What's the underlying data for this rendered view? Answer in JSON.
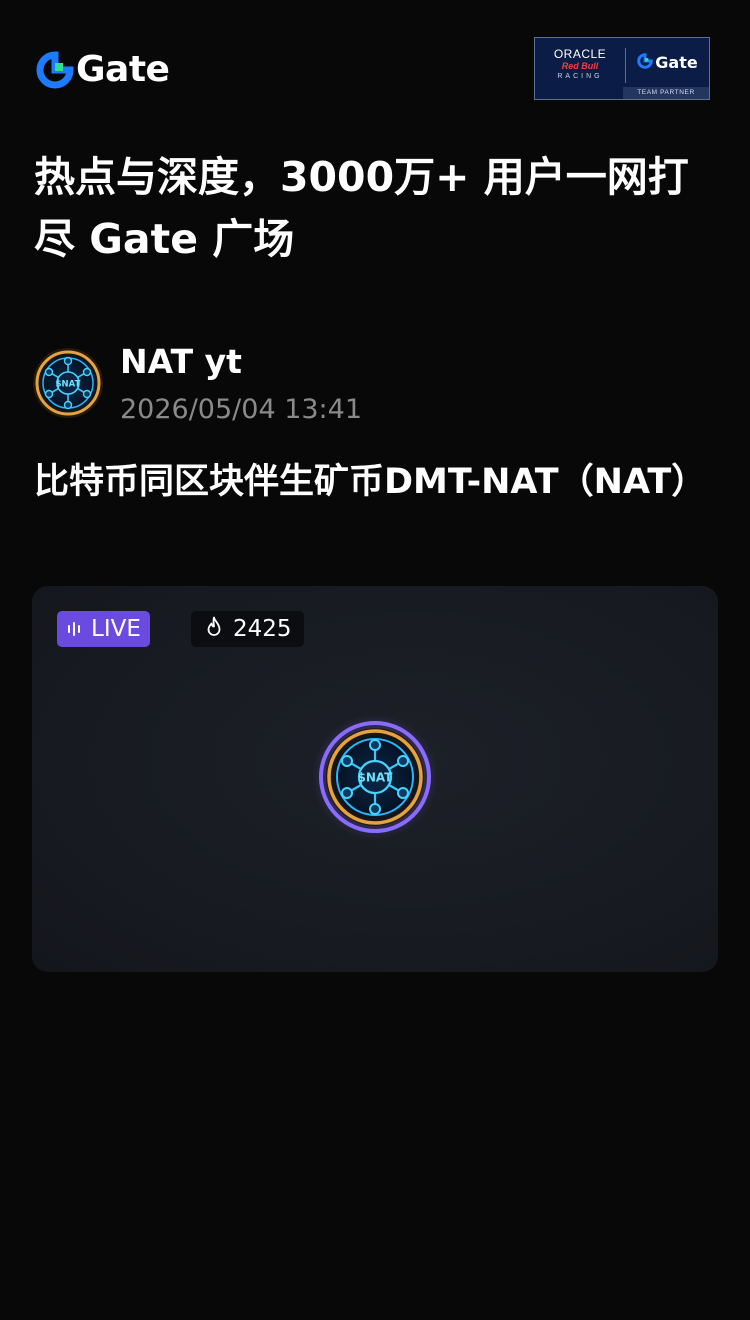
{
  "header": {
    "logo_text": "Gate",
    "logo_icon": "gate-logo-icon",
    "partner_badge": {
      "line1": "ORACLE",
      "line2": "Red Bull",
      "line3": "RACING",
      "brand": "Gate",
      "footer": "TEAM PARTNER"
    }
  },
  "headline": "热点与深度，3000万+ 用户一网打尽 Gate 广场",
  "post": {
    "author": "NAT yt",
    "time": "2026/05/04 13:41",
    "title": "比特币同区块伴生矿币DMT-NAT（NAT）"
  },
  "live_card": {
    "live_label": "LIVE",
    "viewers": "2425",
    "viewer_icon": "flame-icon",
    "token_label": "$NAT"
  },
  "colors": {
    "background": "#080808",
    "accent_purple": "#6a4be0",
    "gate_blue": "#1e7bff",
    "gate_green": "#2fe28a",
    "muted_text": "#8a8a8a"
  }
}
